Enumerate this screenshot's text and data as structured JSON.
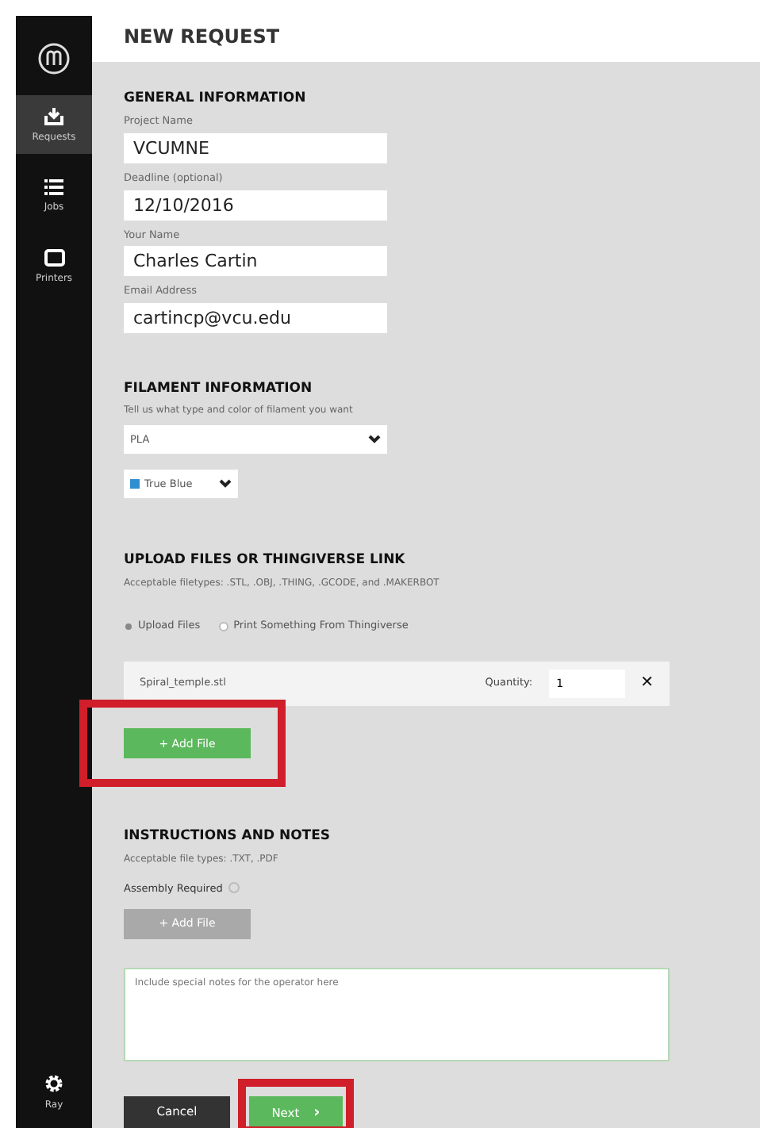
{
  "sidebar": {
    "items": [
      {
        "label": "Requests",
        "kind": "upload",
        "selected": true
      },
      {
        "label": "Jobs",
        "kind": "list",
        "selected": false
      },
      {
        "label": "Printers",
        "kind": "printer",
        "selected": false
      }
    ],
    "user": {
      "label": "Ray"
    }
  },
  "page_title": "NEW REQUEST",
  "general": {
    "heading": "GENERAL INFORMATION",
    "fields": [
      {
        "label": "Project Name",
        "value": "VCUMNE"
      },
      {
        "label": "Deadline (optional)",
        "value": "12/10/2016"
      },
      {
        "label": "Your Name",
        "value": "Charles Cartin"
      },
      {
        "label": "Email Address",
        "value": "cartincp@vcu.edu"
      }
    ]
  },
  "filament": {
    "heading": "FILAMENT INFORMATION",
    "description": "Tell us what type and color of filament you want",
    "type": "PLA",
    "color_name": "True Blue",
    "color": "#2f8fd0"
  },
  "upload": {
    "heading": "UPLOAD FILES OR THINGIVERSE LINK",
    "description": "Acceptable filetypes: .STL, .OBJ, .THING, .GCODE, and .MAKERBOT",
    "options": [
      {
        "label": "Upload Files",
        "selected": true
      },
      {
        "label": "Print Something From Thingiverse",
        "selected": false
      }
    ],
    "files": [
      {
        "name": "Spiral_temple.stl",
        "quantity_label": "Quantity:",
        "quantity": "1",
        "remove": "✕"
      }
    ],
    "add_button": {
      "label": "+ Add File",
      "disabled": false,
      "highlighted": true
    }
  },
  "instructions": {
    "heading": "INSTRUCTIONS AND NOTES",
    "description": "Acceptable file types: .TXT, .PDF",
    "assembly_label": "Assembly Required",
    "assembly_checked": false,
    "add_button": {
      "label": "+ Add File",
      "disabled": true,
      "highlighted": false
    },
    "notes_placeholder": "Include special notes for the operator here"
  },
  "actions": [
    {
      "label": "Cancel",
      "kind": "cancel",
      "highlighted": false
    },
    {
      "label": "Next",
      "kind": "next",
      "arrow": "›",
      "highlighted": true
    }
  ]
}
